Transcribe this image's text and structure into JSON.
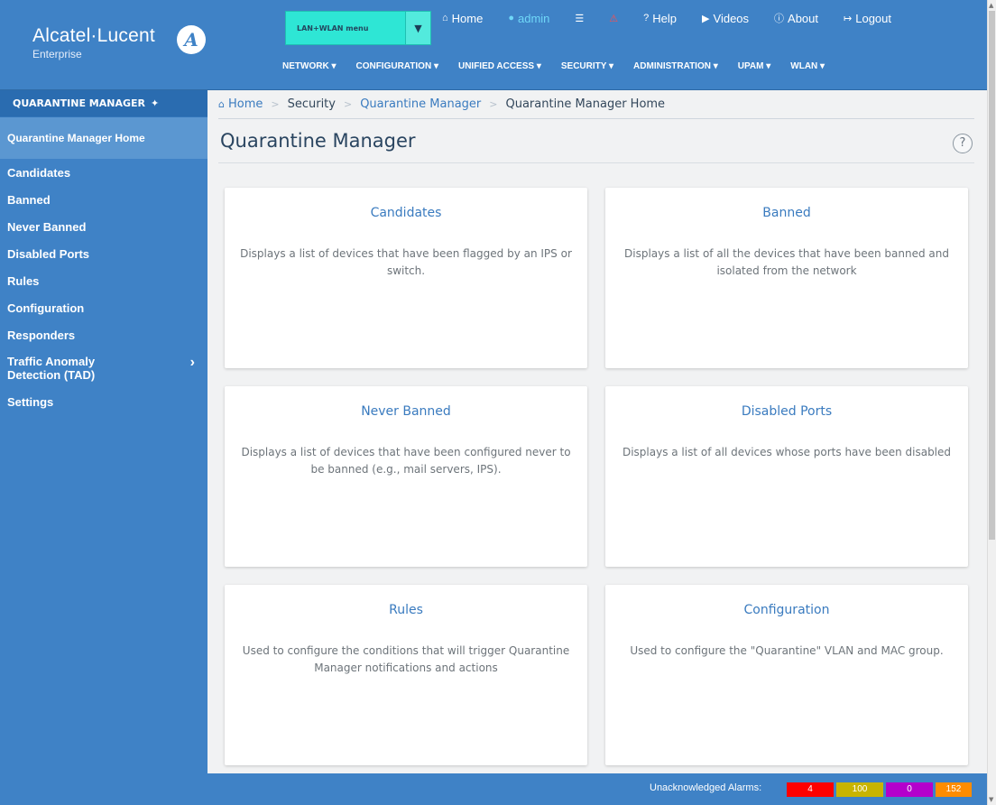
{
  "brand": {
    "name": "Alcatel·Lucent",
    "sub": "Enterprise",
    "logo_glyph": "A"
  },
  "mode_select": {
    "value": "LAN+WLAN menu"
  },
  "top_links": [
    {
      "label": "Home",
      "icon": "home-icon"
    },
    {
      "label": "admin",
      "icon": "user-icon"
    },
    {
      "label": "",
      "icon": "list-icon"
    },
    {
      "label": "",
      "icon": "alarm-bell-icon"
    },
    {
      "label": "Help",
      "icon": "question-icon"
    },
    {
      "label": "Videos",
      "icon": "video-icon"
    },
    {
      "label": "About",
      "icon": "info-icon"
    },
    {
      "label": "Logout",
      "icon": "logout-icon"
    }
  ],
  "main_nav": [
    "NETWORK ▾",
    "CONFIGURATION ▾",
    "UNIFIED ACCESS ▾",
    "SECURITY ▾",
    "ADMINISTRATION ▾",
    "UPAM ▾",
    "WLAN ▾"
  ],
  "sidebar": {
    "title": "QUARANTINE MANAGER",
    "items": [
      {
        "label": "Quarantine Manager Home",
        "active": true
      },
      {
        "label": "Candidates"
      },
      {
        "label": "Banned"
      },
      {
        "label": "Never Banned"
      },
      {
        "label": "Disabled Ports"
      },
      {
        "label": "Rules"
      },
      {
        "label": "Configuration"
      },
      {
        "label": "Responders"
      },
      {
        "label": "Traffic Anomaly Detection (TAD)",
        "has_submenu": true
      },
      {
        "label": "Settings"
      }
    ]
  },
  "breadcrumb": [
    "Home",
    "Security",
    "Quarantine Manager",
    "Quarantine Manager Home"
  ],
  "page_title": "Quarantine Manager",
  "help_glyph": "?",
  "cards": [
    {
      "title": "Candidates",
      "desc": "Displays a list of devices that have been flagged by an IPS or switch."
    },
    {
      "title": "Banned",
      "desc": "Displays a list of all the devices that have been banned and isolated from the network"
    },
    {
      "title": "Never Banned",
      "desc": "Displays a list of devices that have been configured never to be banned (e.g., mail servers, IPS)."
    },
    {
      "title": "Disabled Ports",
      "desc": "Displays a list of all devices whose ports have been disabled"
    },
    {
      "title": "Rules",
      "desc": "Used to configure the conditions that will trigger Quarantine Manager notifications and actions"
    },
    {
      "title": "Configuration",
      "desc": "Used to configure the \"Quarantine\" VLAN and MAC group."
    }
  ],
  "footer": {
    "alarm_label": "Unacknowledged Alarms:",
    "alarms": {
      "critical": "4",
      "major": "100",
      "minor": "0",
      "warning": "152"
    }
  },
  "colors": {
    "header_bg": "#3f82c6",
    "mode_select_bg": "#2ee6d5",
    "link_blue": "#3a7bbf",
    "alarm_critical": "#ff0000",
    "alarm_major": "#c8b400",
    "alarm_minor": "#b400cc",
    "alarm_warning": "#ff8c00"
  }
}
